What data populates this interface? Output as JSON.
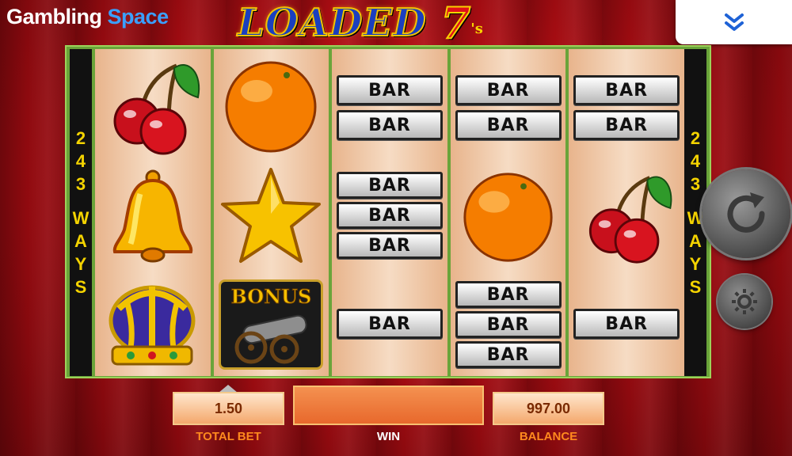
{
  "brand": {
    "name_part1": "Gambling",
    "name_part2": "Space"
  },
  "game_logo": {
    "word": "LOADED",
    "seven": "7",
    "suffix": "'s"
  },
  "ways": {
    "digits": [
      "2",
      "4",
      "3"
    ],
    "letters": [
      "W",
      "A",
      "Y",
      "S"
    ]
  },
  "reels": [
    [
      "cherry",
      "bell",
      "crown"
    ],
    [
      "orange",
      "star",
      "bonus"
    ],
    [
      "bar",
      "bar2",
      "bar3",
      "bar"
    ],
    [
      "bar2",
      "orange",
      "bar3"
    ],
    [
      "bar2",
      "cherry",
      "bar"
    ]
  ],
  "symbols": {
    "bar_label": "BAR",
    "bonus_label": "BONUS"
  },
  "bottom": {
    "total_bet_value": "1.50",
    "total_bet_label": "TOTAL BET",
    "win_value": "",
    "win_label": "WIN",
    "balance_value": "997.00",
    "balance_label": "BALANCE"
  },
  "colors": {
    "accent_yellow": "#f4d300",
    "curtain_red": "#b80e14",
    "frame_green": "#6aa43a",
    "label_orange": "#ff8a1e"
  },
  "icons": {
    "menu": "chevron-double-down-icon",
    "spin": "spin-arrow-icon",
    "settings": "gear-icon"
  }
}
